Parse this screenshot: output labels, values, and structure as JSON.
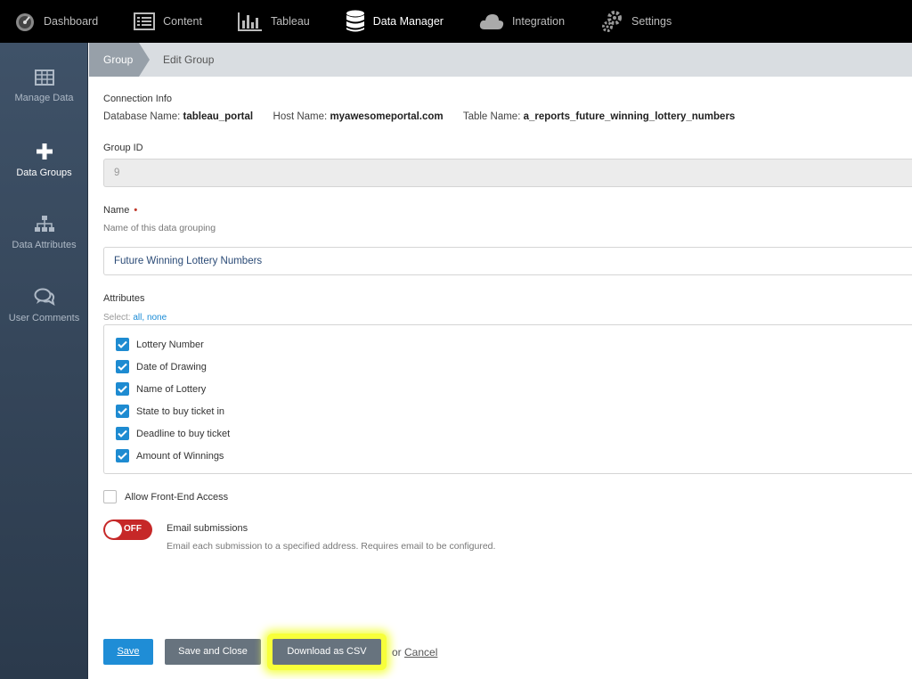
{
  "topnav": {
    "items": [
      {
        "label": "Dashboard",
        "icon": "speedometer-icon"
      },
      {
        "label": "Content",
        "icon": "list-icon"
      },
      {
        "label": "Tableau",
        "icon": "bar-chart-icon"
      },
      {
        "label": "Data Manager",
        "icon": "database-icon",
        "active": true
      },
      {
        "label": "Integration",
        "icon": "cloud-icon"
      },
      {
        "label": "Settings",
        "icon": "gears-icon"
      }
    ]
  },
  "sidebar": {
    "items": [
      {
        "label": "Manage Data",
        "icon": "table-icon"
      },
      {
        "label": "Data Groups",
        "icon": "plus-icon",
        "active": true
      },
      {
        "label": "Data Attributes",
        "icon": "hierarchy-icon"
      },
      {
        "label": "User Comments",
        "icon": "comments-icon"
      }
    ]
  },
  "breadcrumb": {
    "group": "Group",
    "current": "Edit Group"
  },
  "connection": {
    "heading": "Connection Info",
    "db_label": "Database Name:",
    "db_value": "tableau_portal",
    "host_label": "Host Name:",
    "host_value": "myawesomeportal.com",
    "table_label": "Table Name:",
    "table_value": "a_reports_future_winning_lottery_numbers"
  },
  "group_id": {
    "label": "Group ID",
    "value": "9"
  },
  "name": {
    "label": "Name",
    "required_mark": "•",
    "help": "Name of this data grouping",
    "value": "Future Winning Lottery Numbers"
  },
  "attributes": {
    "label": "Attributes",
    "select_prefix": "Select:",
    "select_all": "all,",
    "select_none": "none",
    "items": [
      {
        "label": "Lottery Number",
        "checked": true
      },
      {
        "label": "Date of Drawing",
        "checked": true
      },
      {
        "label": "Name of Lottery",
        "checked": true
      },
      {
        "label": "State to buy ticket in",
        "checked": true
      },
      {
        "label": "Deadline to buy ticket",
        "checked": true
      },
      {
        "label": "Amount of Winnings",
        "checked": true
      }
    ]
  },
  "front_end_access": {
    "label": "Allow Front-End Access",
    "checked": false
  },
  "email": {
    "toggle_state": "OFF",
    "title": "Email submissions",
    "help": "Email each submission to a specified address. Requires email to be configured."
  },
  "actions": {
    "save": "Save",
    "save_close": "Save and Close",
    "download_csv": "Download as CSV",
    "or": "or",
    "cancel": "Cancel"
  },
  "colors": {
    "accent": "#1f8dd6",
    "toggle_off": "#c62828",
    "highlight": "#f7ff3a"
  }
}
